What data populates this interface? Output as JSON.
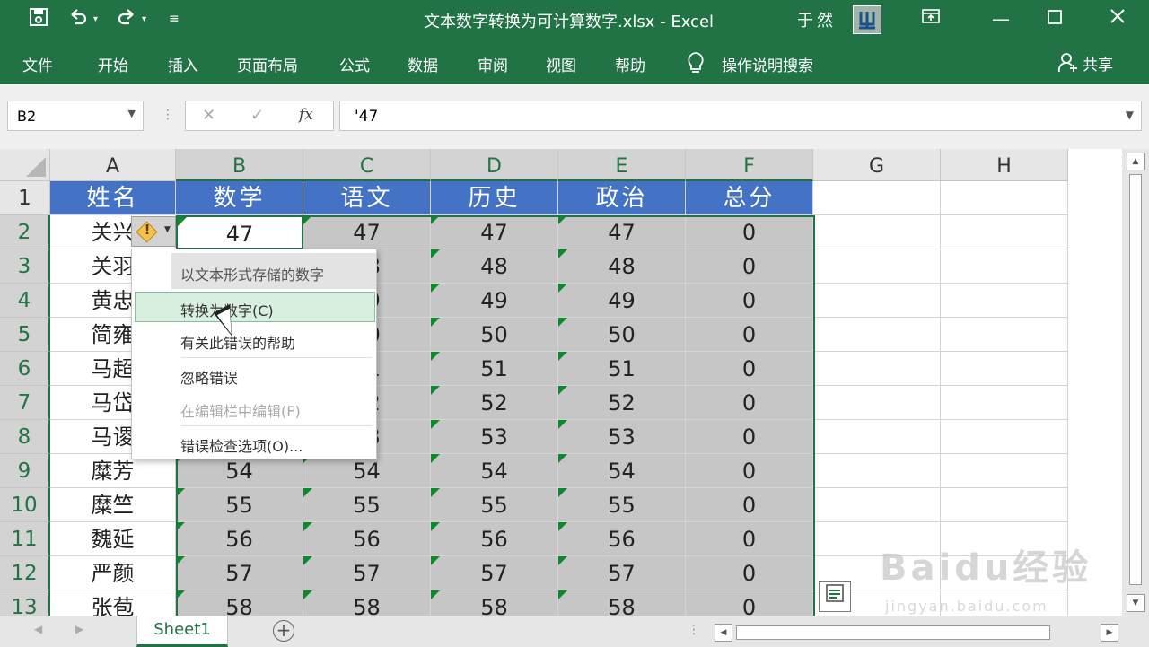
{
  "window": {
    "title": "文本数字转换为可计算数字.xlsx  -  Excel",
    "user": "于然",
    "quick_access": {
      "save_icon": "save-icon",
      "undo_icon": "undo-icon",
      "redo_icon": "redo-icon",
      "customize_icon": "customize-icon"
    },
    "controls": {
      "ribbon_display_icon": "ribbon-display-icon",
      "minimize_icon": "minimize-icon",
      "maximize_icon": "maximize-icon",
      "close_icon": "close-icon"
    }
  },
  "ribbon": {
    "tabs": [
      "文件",
      "开始",
      "插入",
      "页面布局",
      "公式",
      "数据",
      "审阅",
      "视图",
      "帮助"
    ],
    "tell_me": "操作说明搜索",
    "share": "共享"
  },
  "formula_bar": {
    "name_box": "B2",
    "fx": "fx",
    "content": "'47"
  },
  "grid": {
    "columns": [
      "A",
      "B",
      "C",
      "D",
      "E",
      "F",
      "G",
      "H"
    ],
    "rows": [
      "1",
      "2",
      "3",
      "4",
      "5",
      "6",
      "7",
      "8",
      "9",
      "10",
      "11",
      "12",
      "13"
    ],
    "header_row": [
      "姓名",
      "数学",
      "语文",
      "历史",
      "政治",
      "总分"
    ],
    "names": [
      "关兴",
      "关羽",
      "黄忠",
      "简雍",
      "马超",
      "马岱",
      "马谡",
      "糜芳",
      "糜竺",
      "魏延",
      "严颜",
      "张苞"
    ],
    "scores": [
      "47",
      "48",
      "49",
      "50",
      "51",
      "52",
      "53",
      "54",
      "55",
      "56",
      "57",
      "58"
    ],
    "total": "0"
  },
  "error_menu": {
    "header": "以文本形式存储的数字",
    "items": [
      {
        "label": "转换为数字(C)",
        "enabled": true
      },
      {
        "label": "有关此错误的帮助",
        "enabled": true
      },
      {
        "label": "忽略错误",
        "enabled": true
      },
      {
        "label": "在编辑栏中编辑(F)",
        "enabled": false
      },
      {
        "label": "错误检查选项(O)...",
        "enabled": true
      }
    ]
  },
  "sheets": [
    "Sheet1"
  ],
  "watermark": {
    "logo": "Baidu经验",
    "url": "jingyan.baidu.com"
  },
  "colors": {
    "excel_green": "#217346",
    "header_blue": "#4472c4",
    "selection_gray": "#c6c6c6",
    "error_triangle": "#0a8a2a"
  }
}
